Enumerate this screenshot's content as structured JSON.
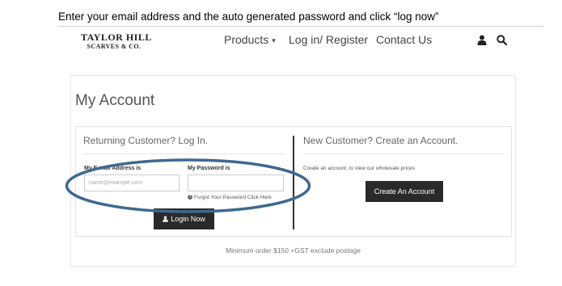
{
  "instruction": "Enter your email address and the auto generated password and click “log now”",
  "logo": {
    "line1": "TAYLOR HILL",
    "line2": "SCARVES & CO."
  },
  "nav": {
    "products": "Products",
    "products_caret": "▾",
    "login_register": "Log in/ Register",
    "contact": "Contact Us",
    "icons": [
      "user-icon",
      "search-icon"
    ]
  },
  "account": {
    "title": "My Account",
    "returning": {
      "title": "Returning Customer? Log In.",
      "email_label": "My E-mail Address is",
      "email_placeholder": "name@example.com",
      "email_value": "",
      "password_label": "My Password is",
      "password_value": "",
      "forgot_text": "Forgot Your Password",
      "forgot_link": "Click Here",
      "login_button": "Login Now"
    },
    "new_customer": {
      "title": "New Customer? Create an Account.",
      "description": "Create an account, to view our wholesale prices",
      "create_button": "Create An Account"
    },
    "footer_note": "Minimum order $150 +GST exclude postage"
  },
  "colors": {
    "button_bg": "#2a2a2a",
    "annotation_ellipse": "#3e6990",
    "divider": "#333333"
  }
}
